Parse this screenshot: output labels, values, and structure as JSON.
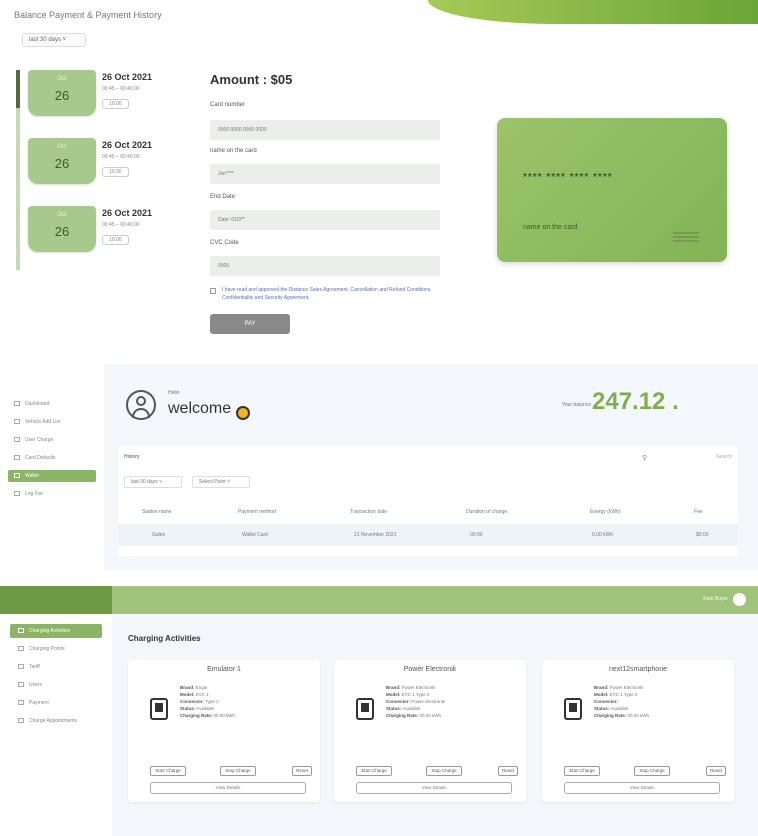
{
  "payment": {
    "title": "Balance Payment & Payment History",
    "filter": "last 30 days ˅",
    "history": [
      {
        "month": "Oct",
        "day": "26",
        "date": "26 Oct 2021",
        "time": "00:45 – 00:40:00",
        "badge": "10.00"
      },
      {
        "month": "Oct",
        "day": "26",
        "date": "26 Oct 2021",
        "time": "00:45 – 00:40:00",
        "badge": "10.00"
      },
      {
        "month": "Oct",
        "day": "26",
        "date": "26 Oct 2021",
        "time": "00:45 – 00:40:00",
        "badge": "10.00"
      }
    ],
    "amount": "Amount : $05",
    "fields": [
      {
        "label": "Card number",
        "placeholder": "0000 0000 0000 0000"
      },
      {
        "label": "name on the card",
        "placeholder": "Jon****"
      },
      {
        "label": "End Date",
        "placeholder": "Date: 01/0**"
      },
      {
        "label": "CVC Code",
        "placeholder": "0000"
      }
    ],
    "agreement": "I have read and approved the Distance Sales Agreement, Cancellation and Refund Conditions, Confidentiality and Security Agreement.",
    "pay_button": "PAY",
    "card": {
      "number": "**** **** **** ****",
      "name": "name on the card"
    }
  },
  "dashboard": {
    "nav": [
      {
        "label": "Dashboard",
        "active": false
      },
      {
        "label": "Vehicle Add List",
        "active": false
      },
      {
        "label": "User Charge",
        "active": false
      },
      {
        "label": "Card Defaults",
        "active": false
      },
      {
        "label": "Wallet",
        "active": true
      },
      {
        "label": "Log Out",
        "active": false
      }
    ],
    "hello": "Hello",
    "welcome": "welcome",
    "balance_label": "Your balance",
    "balance": "247.12 .",
    "history": {
      "title": "History",
      "search": "Search",
      "filters": [
        "last 30 days ˅",
        "Select Point ˅"
      ],
      "columns": [
        "Station name",
        "Payment method",
        "Transaction date",
        "Duration of charge",
        "Energy (kWh)",
        "Fee"
      ],
      "rows": [
        [
          "Galen",
          "Wallet Card",
          "21 November 2021",
          "00:00",
          "0.00 kWh",
          "$0.00"
        ]
      ]
    }
  },
  "charging": {
    "user": "Kate Buyer",
    "nav": [
      {
        "label": "Charging Activities",
        "active": true
      },
      {
        "label": "Charging Points",
        "active": false
      },
      {
        "label": "Tariff",
        "active": false
      },
      {
        "label": "Users",
        "active": false
      },
      {
        "label": "Payment",
        "active": false
      },
      {
        "label": "Charge Appointments",
        "active": false
      }
    ],
    "heading": "Charging Activities",
    "stations": [
      {
        "name": "Emulator 1",
        "lines": [
          [
            "Brand:",
            "Engie"
          ],
          [
            "Model:",
            "EVC 1"
          ],
          [
            "Connector:",
            "Type 2"
          ],
          [
            "Status:",
            "Available"
          ],
          [
            "Charging Rate:",
            "00.00 kWh"
          ]
        ],
        "buttons": [
          "Start Charge",
          "Stop Charge",
          "Reset"
        ],
        "details": "View Details"
      },
      {
        "name": "Power Electronik",
        "lines": [
          [
            "Brand:",
            "Power Electronik"
          ],
          [
            "Model:",
            "EVC 1 Type 2"
          ],
          [
            "Connector:",
            "Power Electronik"
          ],
          [
            "Status:",
            "Available"
          ],
          [
            "Charging Rate:",
            "00.00 kWh"
          ]
        ],
        "buttons": [
          "Start Charge",
          "Stop Charge",
          "Reset"
        ],
        "details": "View Details"
      },
      {
        "name": "next12smartphone",
        "lines": [
          [
            "Brand:",
            "Power Electronik"
          ],
          [
            "Model:",
            "EVC 1 Type 2"
          ],
          [
            "Connector:",
            ""
          ],
          [
            "Status:",
            "Available"
          ],
          [
            "Charging Rate:",
            "00.00 kWh"
          ]
        ],
        "buttons": [
          "Start Charge",
          "Stop Charge",
          "Reset"
        ],
        "details": "View Details"
      }
    ]
  }
}
